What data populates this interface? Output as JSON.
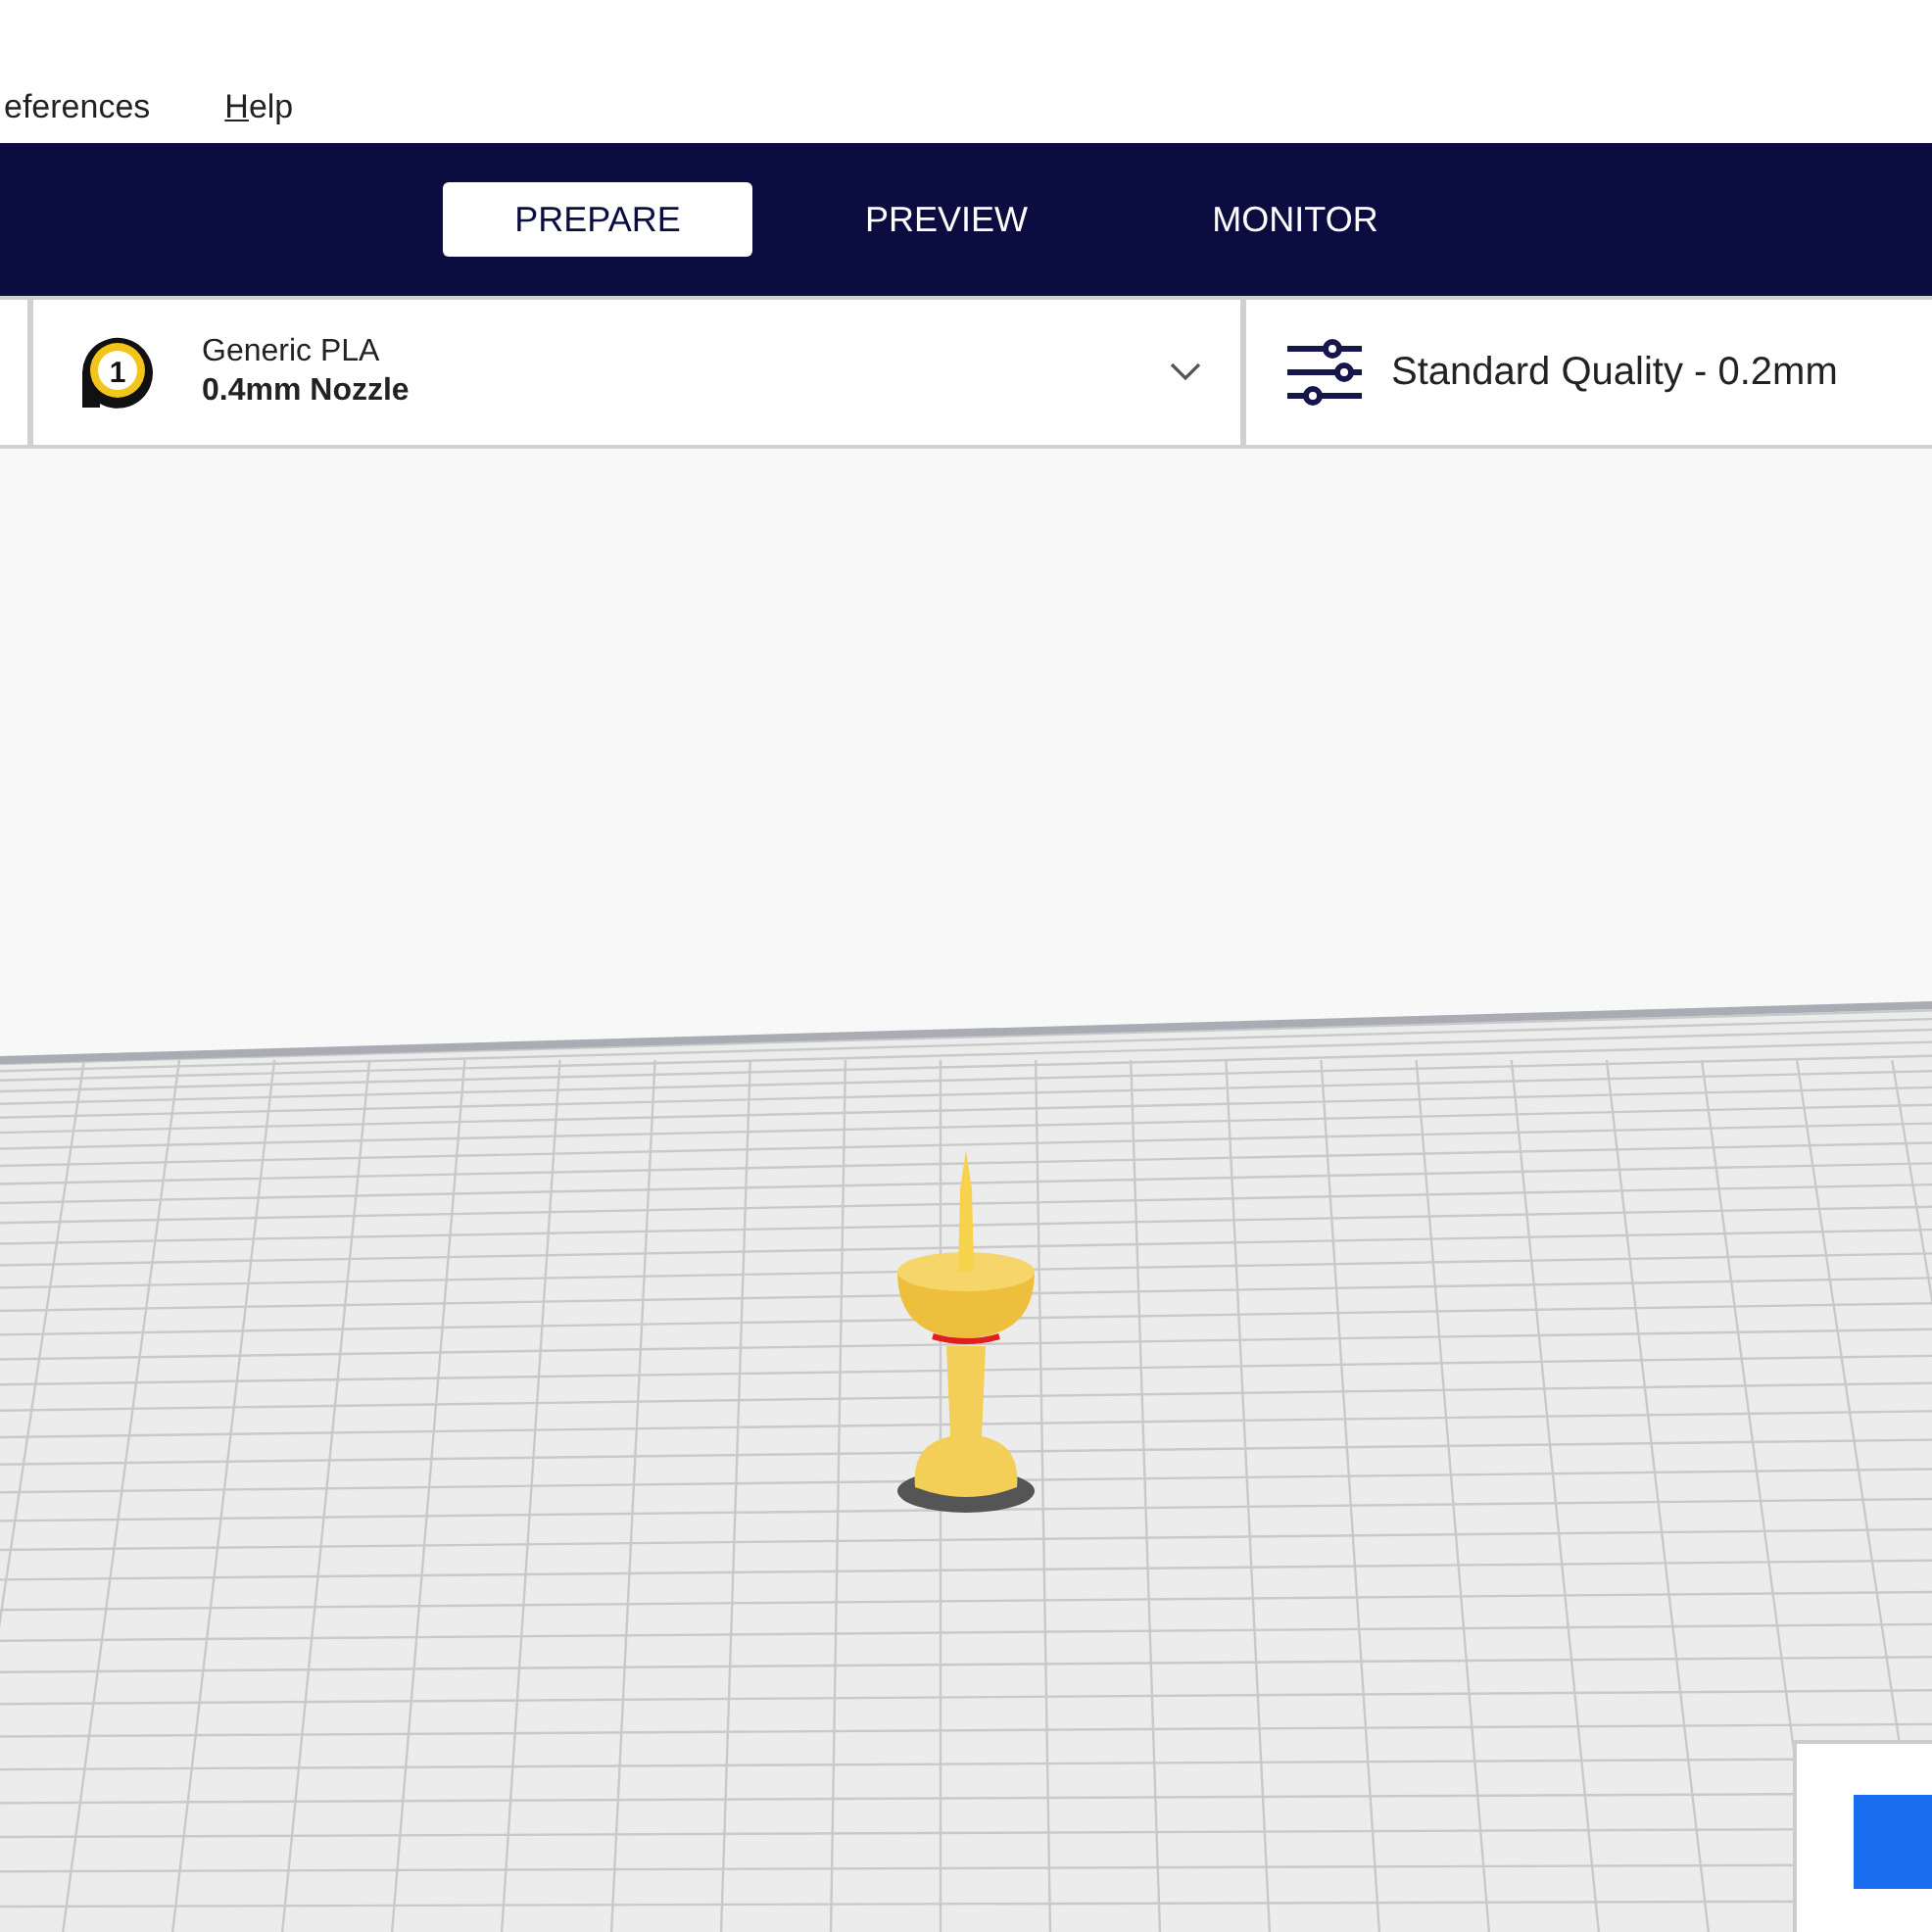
{
  "menu": [
    {
      "label": "eferences",
      "mnemonic": false
    },
    {
      "label": "Help",
      "mnemonic": true
    }
  ],
  "stages": [
    {
      "label": "PREPARE",
      "selected": true
    },
    {
      "label": "PREVIEW",
      "selected": false
    },
    {
      "label": "MONITOR",
      "selected": false
    }
  ],
  "extruder": {
    "number": "1",
    "material": "Generic PLA",
    "nozzle": "0.4mm Nozzle"
  },
  "print_settings": {
    "profile": "Standard Quality - 0.2mm"
  }
}
